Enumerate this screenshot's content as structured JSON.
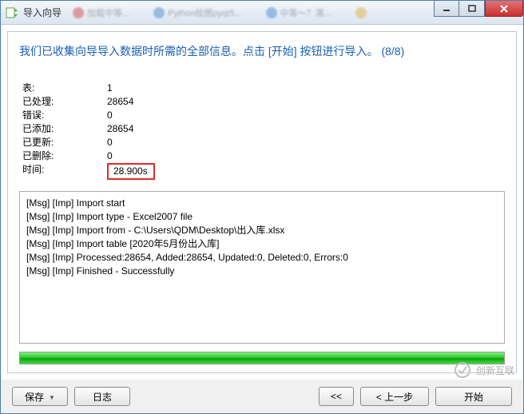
{
  "titlebar": {
    "title": "导入向导",
    "blur_items": [
      "加载中等...",
      "Python绘图pyqt5...",
      "中等～？演...",
      ""
    ]
  },
  "header": {
    "message": "我们已收集向导导入数据时所需的全部信息。点击 [开始] 按钮进行导入。 (8/8)"
  },
  "stats": {
    "rows": [
      {
        "label": "表:",
        "value": "1",
        "highlight": false
      },
      {
        "label": "已处理:",
        "value": "28654",
        "highlight": false
      },
      {
        "label": "错误:",
        "value": "0",
        "highlight": false
      },
      {
        "label": "已添加:",
        "value": "28654",
        "highlight": false
      },
      {
        "label": "已更新:",
        "value": "0",
        "highlight": false
      },
      {
        "label": "已删除:",
        "value": "0",
        "highlight": false
      },
      {
        "label": "时间:",
        "value": "28.900s",
        "highlight": true
      }
    ]
  },
  "log": {
    "lines": [
      "[Msg] [Imp] Import start",
      "[Msg] [Imp] Import type - Excel2007 file",
      "[Msg] [Imp] Import from - C:\\Users\\QDM\\Desktop\\出入库.xlsx",
      "[Msg] [Imp] Import table [2020年5月份出入库]",
      "[Msg] [Imp] Processed:28654, Added:28654, Updated:0, Deleted:0, Errors:0",
      "[Msg] [Imp] Finished - Successfully"
    ]
  },
  "progress": {
    "percent": 100
  },
  "buttons": {
    "save": "保存",
    "log": "日志",
    "first": "<<",
    "prev": "< 上一步",
    "start": "开始"
  },
  "watermark": {
    "text": "创新互联"
  },
  "colors": {
    "header_blue": "#1a5fb4",
    "highlight_red": "#e02a2a",
    "progress_green": "#2ecc2e"
  }
}
